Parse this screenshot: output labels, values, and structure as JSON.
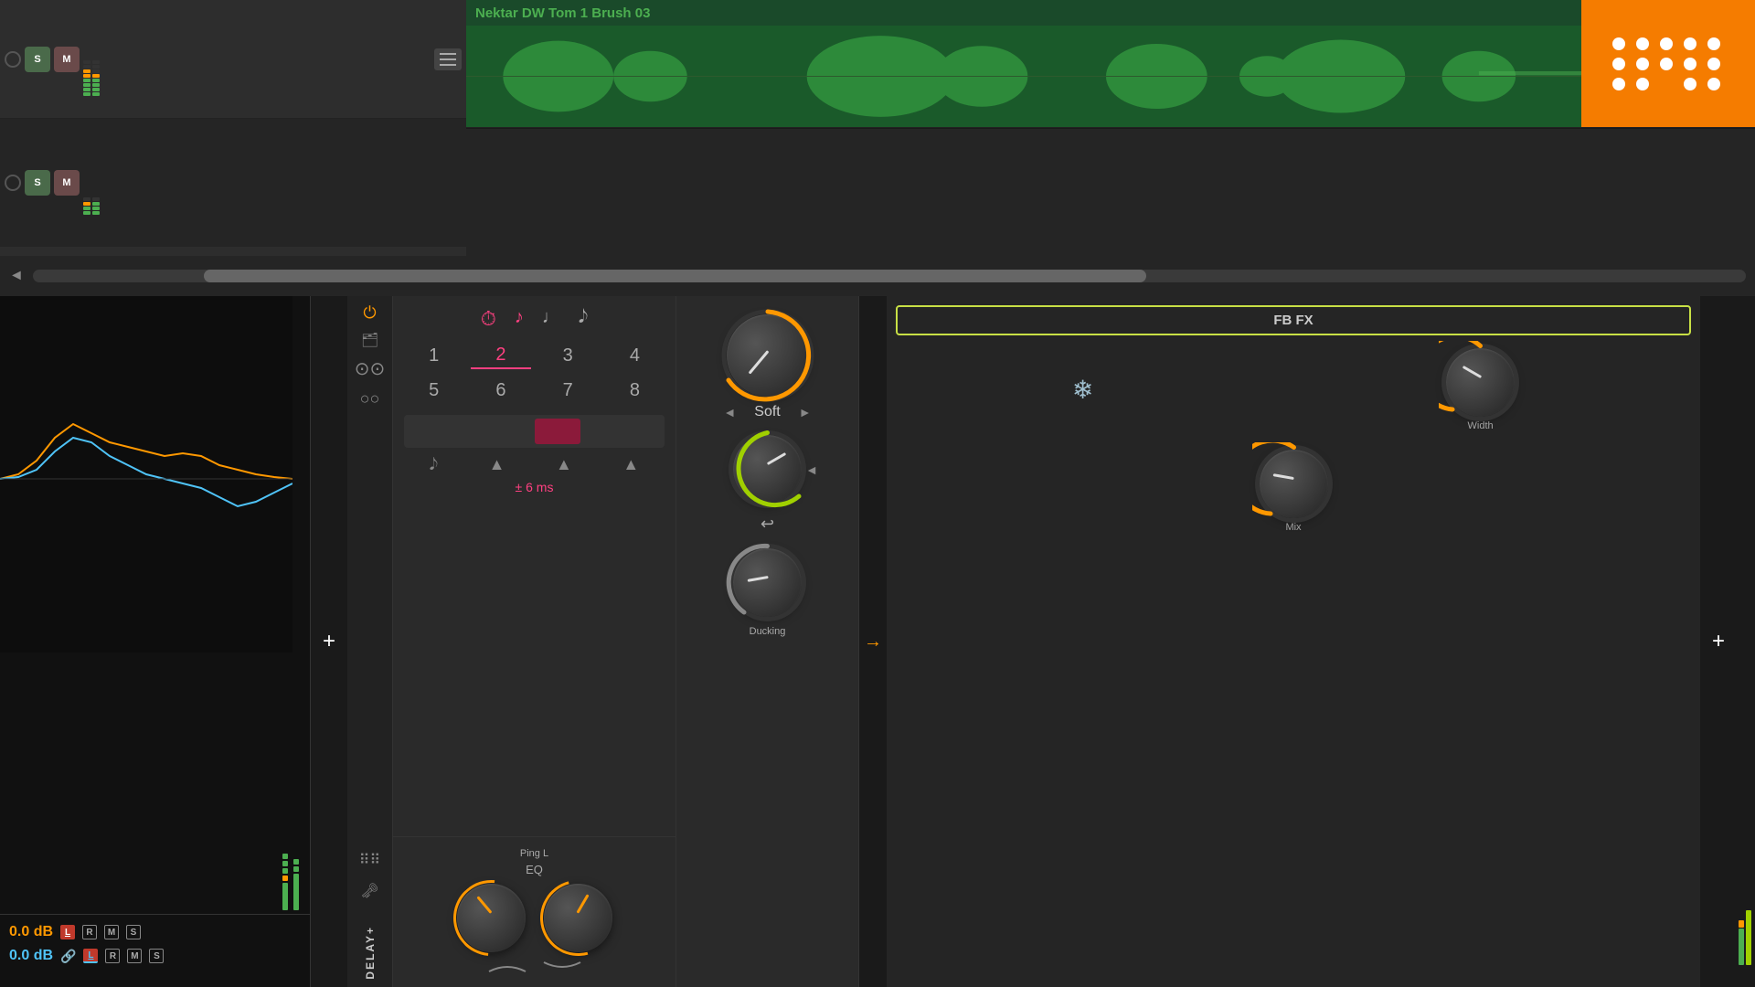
{
  "daw": {
    "track1": {
      "name": "Nektar DW Tom 1 Brush 03",
      "s_label": "S",
      "m_label": "M"
    },
    "track2": {
      "s_label": "S",
      "m_label": "M"
    }
  },
  "plugin": {
    "name": "DELAY+",
    "power_icon": "⏻",
    "folder_icon": "📁",
    "note_icons": [
      "⏱",
      "♪",
      "♩",
      "♩"
    ],
    "grid_numbers": [
      "1",
      "2",
      "3",
      "4",
      "5",
      "6",
      "7",
      "8"
    ],
    "active_grid": "2",
    "delay_ms": "± 6 ms",
    "eq_label": "EQ",
    "ping_label": "Ping L",
    "soft_label": "Soft",
    "ducking_label": "Ducking",
    "width_label": "Width",
    "mix_label": "Mix",
    "fbfx_label": "FB FX",
    "left_arrow": "◄",
    "right_arrow": "►"
  },
  "levels": {
    "orange_db": "0.0 dB",
    "blue_db": "0.0 dB",
    "l_label": "L",
    "r_label": "R",
    "m_label": "M",
    "s_label": "S",
    "link_icon": "🔗"
  },
  "add_icon": "+",
  "icons": {
    "power": "⏻",
    "folder": "🗂",
    "link": "⊙⊙",
    "circle_small": "○○",
    "dots": "⠿⠿",
    "key": "🗝",
    "snowflake": "❄",
    "arrow_right": "→",
    "return": "↩"
  }
}
